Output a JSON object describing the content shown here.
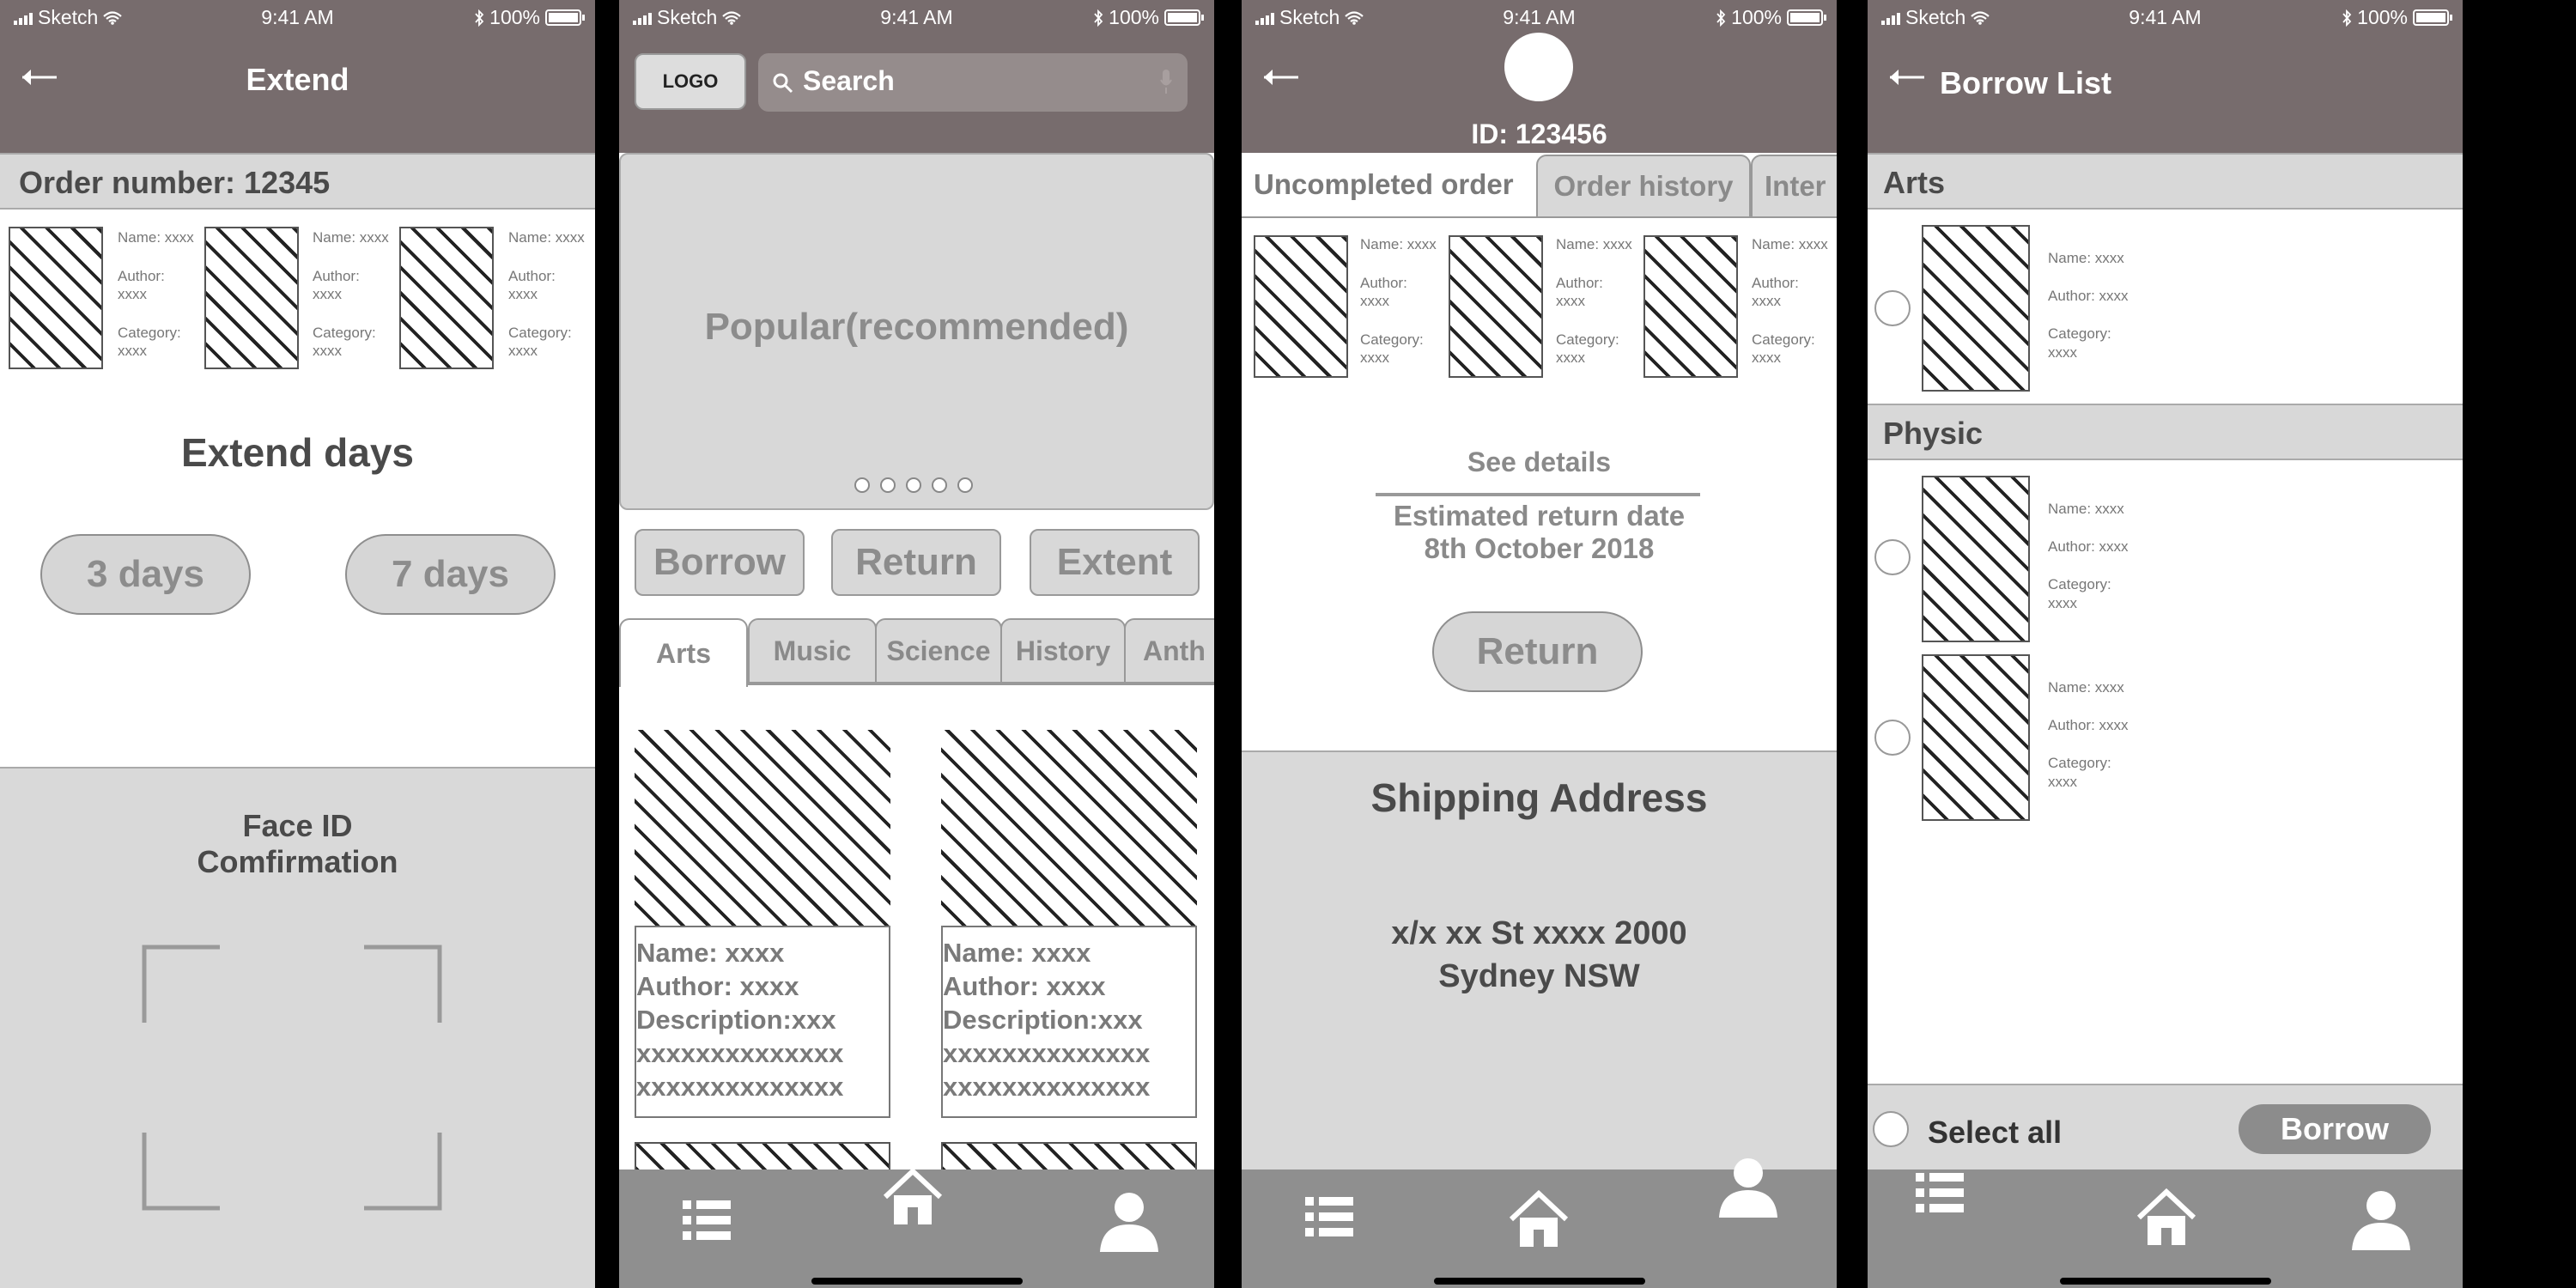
{
  "status": {
    "carrier": "Sketch",
    "time": "9:41 AM",
    "battery": "100%"
  },
  "extend": {
    "title": "Extend",
    "order_number": "Order number: 12345",
    "books": [
      {
        "name": "Name: xxxx",
        "author": "Author:",
        "author_val": "xxxx",
        "category": "Category:",
        "category_val": "xxxx"
      },
      {
        "name": "Name: xxxx",
        "author": "Author:",
        "author_val": "xxxx",
        "category": "Category:",
        "category_val": "xxxx"
      },
      {
        "name": "Name: xxxx",
        "author": "Author:",
        "author_val": "xxxx",
        "category": "Category:",
        "category_val": "xxxx"
      }
    ],
    "extend_days": "Extend days",
    "option_3": "3 days",
    "option_7": "7 days",
    "faceid_line1": "Face ID",
    "faceid_line2": "Comfirmation"
  },
  "home": {
    "logo": "LOGO",
    "search_placeholder": "Search",
    "banner": "Popular(recommended)",
    "actions": [
      "Borrow",
      "Return",
      "Extent"
    ],
    "tabs": [
      "Arts",
      "Music",
      "Science",
      "History",
      "Anth"
    ],
    "cards": [
      {
        "name": "Name: xxxx",
        "author": "Author: xxxx",
        "desc": "Description:xxx",
        "l1": "xxxxxxxxxxxxxx",
        "l2": "xxxxxxxxxxxxxx"
      },
      {
        "name": "Name: xxxx",
        "author": "Author: xxxx",
        "desc": "Description:xxx",
        "l1": "xxxxxxxxxxxxxx",
        "l2": "xxxxxxxxxxxxxx"
      }
    ]
  },
  "profile": {
    "id": "ID: 123456",
    "tabs": [
      "Uncompleted order",
      "Order history",
      "Inter"
    ],
    "books": [
      {
        "name": "Name: xxxx",
        "author": "Author:",
        "author_val": "xxxx",
        "category": "Category:",
        "category_val": "xxxx"
      },
      {
        "name": "Name: xxxx",
        "author": "Author:",
        "author_val": "xxxx",
        "category": "Category:",
        "category_val": "xxxx"
      },
      {
        "name": "Name: xxxx",
        "author": "Author:",
        "author_val": "xxxx",
        "category": "Category:",
        "category_val": "xxxx"
      }
    ],
    "see_details": "See details",
    "est_label": "Estimated return date",
    "est_date": "8th October 2018",
    "return_btn": "Return",
    "shipping_title": "Shipping Address",
    "addr1": "x/x xx St xxxx 2000",
    "addr2": "Sydney NSW"
  },
  "borrow": {
    "title": "Borrow List",
    "sections": [
      {
        "name": "Arts",
        "items": [
          {
            "name": "Name: xxxx",
            "author": "Author: xxxx",
            "category": "Category:",
            "category_val": "xxxx"
          }
        ]
      },
      {
        "name": "Physic",
        "items": [
          {
            "name": "Name: xxxx",
            "author": "Author: xxxx",
            "category": "Category:",
            "category_val": "xxxx"
          },
          {
            "name": "Name: xxxx",
            "author": "Author: xxxx",
            "category": "Category:",
            "category_val": "xxxx"
          }
        ]
      }
    ],
    "select_all": "Select all",
    "borrow_btn": "Borrow"
  },
  "colors": {
    "header": "#776c6d",
    "gray_bar": "#d8d8d8",
    "tab_bar": "#8f8f8f"
  },
  "icons": [
    "back-arrow-icon",
    "search-icon",
    "microphone-icon",
    "list-icon",
    "home-icon",
    "user-icon",
    "wifi-icon",
    "bluetooth-icon",
    "battery-icon"
  ]
}
